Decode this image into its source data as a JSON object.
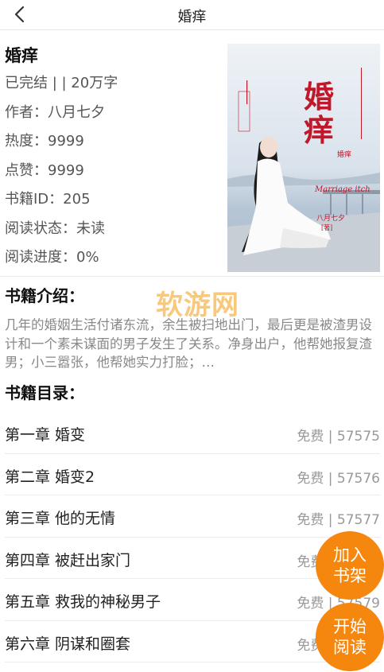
{
  "header": {
    "title": "婚痒",
    "back_icon": "chevron-left-icon"
  },
  "book": {
    "title": "婚痒",
    "status_line": "已完结 | | 20万字",
    "author_line": "作者：八月七夕",
    "popularity_line": "热度：9999",
    "likes_line": "点赞：9999",
    "book_id_line": "书籍ID：205",
    "read_status_line": "阅读状态：未读",
    "read_progress_line": "阅读进度：0%"
  },
  "cover": {
    "title": "婚痒",
    "subtitle": "Marriage itch",
    "author": "八月七夕",
    "author_suffix": "[著]",
    "side_text": "婚痒"
  },
  "watermark": "软游网",
  "intro": {
    "heading": "书籍介绍：",
    "text": "几年的婚姻生活付诸东流，余生被扫地出门，最后更是被渣男设计和一个素未谋面的男子发生了关系。净身出户，他帮她报复渣男；小三嚣张，他帮她实力打脸；…"
  },
  "toc": {
    "heading": "书籍目录：",
    "chapters": [
      {
        "name": "第一章 婚变",
        "meta": "免费 | 57575"
      },
      {
        "name": "第二章 婚变2",
        "meta": "免费 | 57576"
      },
      {
        "name": "第三章 他的无情",
        "meta": "免费 | 57577"
      },
      {
        "name": "第四章 被赶出家门",
        "meta": "免费 | 57578"
      },
      {
        "name": "第五章 救我的神秘男子",
        "meta": "免费 | 57579"
      },
      {
        "name": "第六章 阴谋和圈套",
        "meta": "免费 | 57580"
      }
    ]
  },
  "actions": {
    "add_shelf": "加入书架",
    "start_read": "开始阅读"
  },
  "colors": {
    "accent": "#f5870f",
    "cover_red": "#c0182a"
  }
}
